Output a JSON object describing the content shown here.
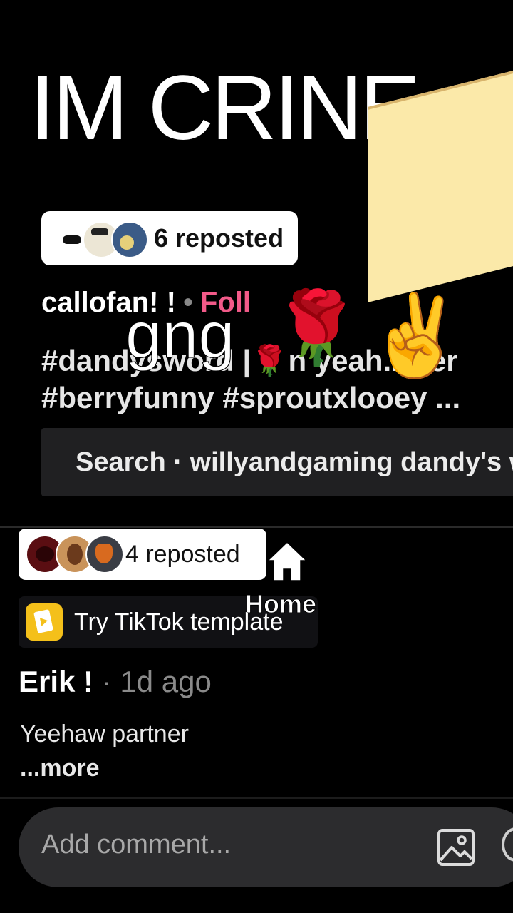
{
  "overlay": {
    "title": "IM CRINE",
    "caption_text": "gng",
    "emojis": [
      "🌹",
      "✌️"
    ]
  },
  "video_post": {
    "reposted_label": "6 reposted",
    "username": "callofan! !",
    "separator": "•",
    "follow_label": "Foll",
    "hashtags_line1": "#dandysword |🌹n yeah.. Ber",
    "hashtags_line2": "#berryfunny #sproutxlooey ...",
    "search_label": "Search · willyandgaming dandy's w"
  },
  "nav": {
    "home_label": "Home"
  },
  "post": {
    "reposted_label": "4 reposted",
    "template_label": "Try TikTok template",
    "author": "Erik !",
    "time": " · 1d ago",
    "caption": "Yeehaw partner",
    "more_label": "...more"
  },
  "comment": {
    "placeholder": "Add comment..."
  },
  "colors": {
    "background": "#000000",
    "follow_accent": "#f25a89",
    "template_icon": "#f4c01a"
  },
  "icons": [
    "home-icon",
    "search-icon",
    "image-icon",
    "mention-icon",
    "tiktok-template-icon"
  ]
}
